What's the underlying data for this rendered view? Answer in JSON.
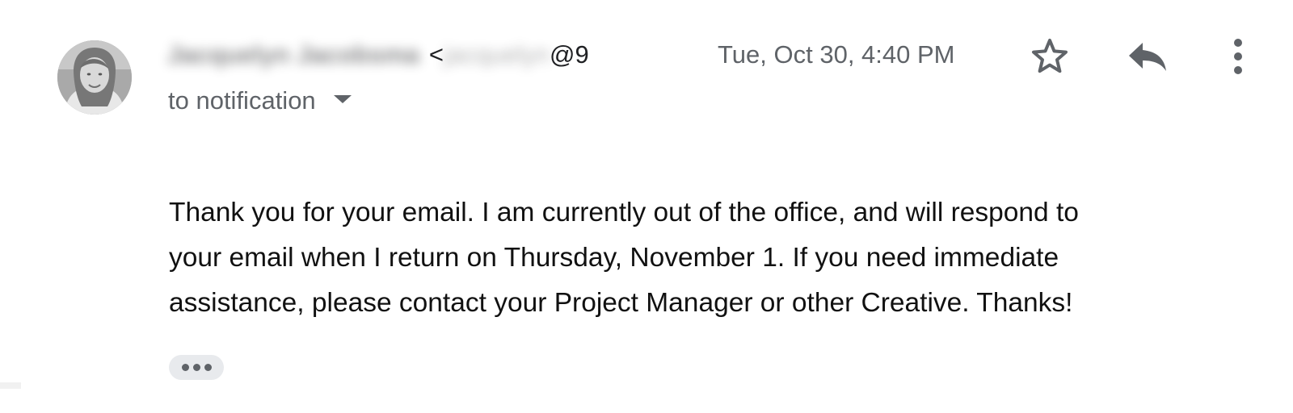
{
  "message": {
    "sender": {
      "name": "Jacquelyn Jacobsma",
      "email_open": "<",
      "email_blurred": "jacquelyn",
      "email_visible": "@9",
      "avatar_icon": "profile-photo"
    },
    "date": "Tue, Oct 30, 4:40 PM",
    "recipient": {
      "label": "to notification",
      "icon": "chevron-down-icon"
    },
    "actions": {
      "star_icon": "star-icon",
      "reply_icon": "reply-icon",
      "more_icon": "more-vertical-icon"
    },
    "body_lines": [
      "Thank you for your email. I am currently out of the office, and will respond to",
      "your email when I return on Thursday, November 1. If you need immediate",
      "assistance, please contact your Project Manager or other Creative. Thanks!"
    ],
    "trimmed_content_icon": "more-horizontal-icon"
  },
  "colors": {
    "secondary_text": "#5f6368",
    "body_text": "#111111",
    "trim_button_background": "#e8eaed"
  }
}
